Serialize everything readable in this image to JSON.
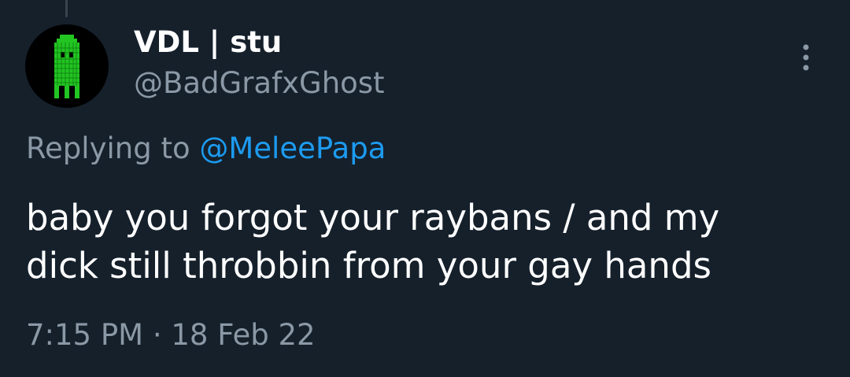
{
  "tweet": {
    "author": {
      "display_name": "VDL | stu",
      "handle": "@BadGrafxGhost",
      "avatar_icon": "pixel-ghost-avatar"
    },
    "reply_prefix": "Replying to",
    "reply_to": "@MeleePapa",
    "text_line_1": "baby you forgot your raybans / and my",
    "text_line_2": "dick still throbbin from your gay hands",
    "time": "7:15 PM",
    "separator": "·",
    "date": "18 Feb 22",
    "more_icon": "more-vertical-icon"
  },
  "colors": {
    "background": "#15202b",
    "text_primary": "#ffffff",
    "text_secondary": "#8b98a5",
    "link": "#1d9bf0",
    "avatar_green": "#22c522"
  }
}
